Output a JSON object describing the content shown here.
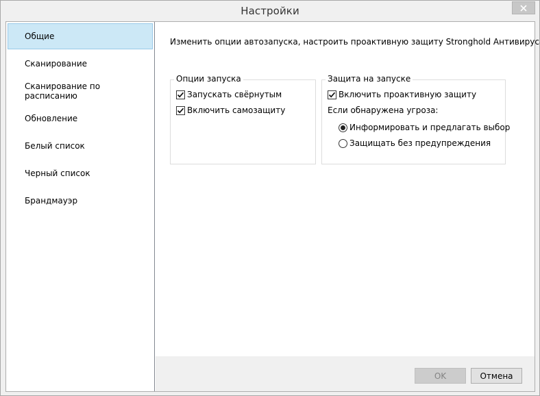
{
  "window": {
    "title": "Настройки",
    "close_icon": "close-icon"
  },
  "sidebar": {
    "items": [
      {
        "label": "Общие",
        "active": true
      },
      {
        "label": "Сканирование",
        "active": false
      },
      {
        "label": "Сканирование по расписанию",
        "active": false
      },
      {
        "label": "Обновление",
        "active": false
      },
      {
        "label": "Белый список",
        "active": false
      },
      {
        "label": "Черный список",
        "active": false
      },
      {
        "label": "Брандмауэр",
        "active": false
      }
    ]
  },
  "main": {
    "description": "Изменить опции автозапуска, настроить проактивную защиту Stronghold Антивируса.",
    "startup_options": {
      "title": "Опции запуска",
      "items": [
        {
          "label": "Запускать свёрнутым",
          "checked": true
        },
        {
          "label": "Включить самозащиту",
          "checked": true
        }
      ]
    },
    "startup_protection": {
      "title": "Защита на запуске",
      "enable_proactive": {
        "label": "Включить проактивную защиту",
        "checked": true
      },
      "threat_label": "Если обнаружена угроза:",
      "radio_options": [
        {
          "label": "Информировать и предлагать выбор",
          "selected": true
        },
        {
          "label": "Защищать без предупреждения",
          "selected": false
        }
      ]
    }
  },
  "footer": {
    "ok_label": "OK",
    "ok_enabled": false,
    "cancel_label": "Отмена"
  },
  "colors": {
    "nav_selected_bg": "#cce8f6",
    "nav_selected_border": "#99c9e8",
    "dialog_bg": "#f0f0f0"
  }
}
